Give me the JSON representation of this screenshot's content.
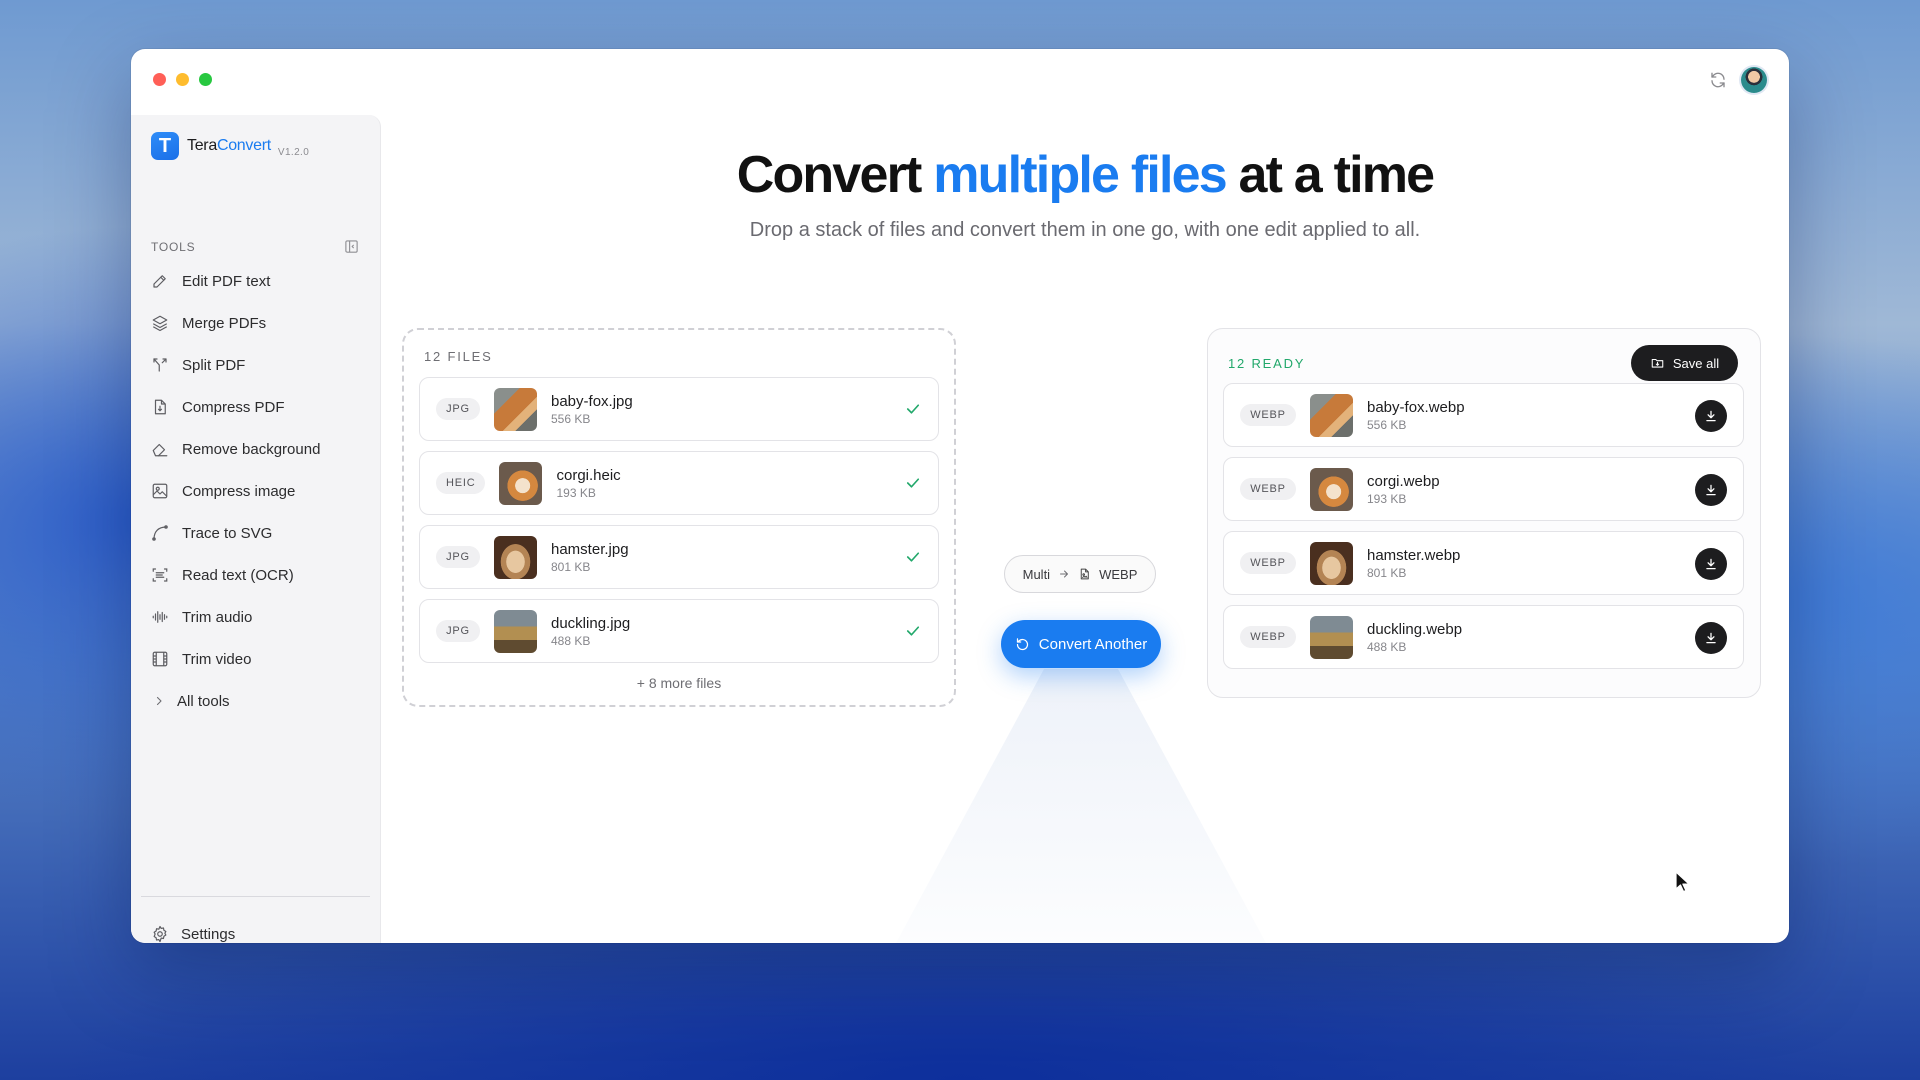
{
  "app": {
    "name_prefix": "Tera",
    "name_accent": "Convert",
    "version": "V1.2.0",
    "logo_glyph": "T",
    "accent_color": "#1a7cf0",
    "success_color": "#22a86b"
  },
  "sidebar": {
    "section_label": "TOOLS",
    "items": [
      {
        "label": "Edit PDF text",
        "icon": "pencil-icon"
      },
      {
        "label": "Merge PDFs",
        "icon": "layers-icon"
      },
      {
        "label": "Split PDF",
        "icon": "split-icon"
      },
      {
        "label": "Compress PDF",
        "icon": "file-compress-icon"
      },
      {
        "label": "Remove background",
        "icon": "eraser-icon"
      },
      {
        "label": "Compress image",
        "icon": "image-compress-icon"
      },
      {
        "label": "Trace to SVG",
        "icon": "bezier-icon"
      },
      {
        "label": "Read text (OCR)",
        "icon": "scan-text-icon"
      },
      {
        "label": "Trim audio",
        "icon": "audio-wave-icon"
      },
      {
        "label": "Trim video",
        "icon": "film-icon"
      }
    ],
    "all_tools_label": "All tools",
    "settings_label": "Settings"
  },
  "header": {
    "title_pre": "Convert ",
    "title_highlight": "multiple files",
    "title_post": " at a time",
    "subtitle": "Drop a stack of files and convert them in one go, with one edit applied to all."
  },
  "source": {
    "label": "12 FILES",
    "files": [
      {
        "format": "JPG",
        "name": "baby-fox.jpg",
        "size": "556 KB"
      },
      {
        "format": "HEIC",
        "name": "corgi.heic",
        "size": "193 KB"
      },
      {
        "format": "JPG",
        "name": "hamster.jpg",
        "size": "801 KB"
      },
      {
        "format": "JPG",
        "name": "duckling.jpg",
        "size": "488 KB"
      }
    ],
    "more_label": "+ 8 more files"
  },
  "route": {
    "from": "Multi",
    "to": "WEBP"
  },
  "convert_button_label": "Convert Another",
  "output": {
    "label": "12 READY",
    "save_all_label": "Save all",
    "files": [
      {
        "format": "WEBP",
        "name": "baby-fox.webp",
        "size": "556 KB"
      },
      {
        "format": "WEBP",
        "name": "corgi.webp",
        "size": "193 KB"
      },
      {
        "format": "WEBP",
        "name": "hamster.webp",
        "size": "801 KB"
      },
      {
        "format": "WEBP",
        "name": "duckling.webp",
        "size": "488 KB"
      }
    ]
  }
}
